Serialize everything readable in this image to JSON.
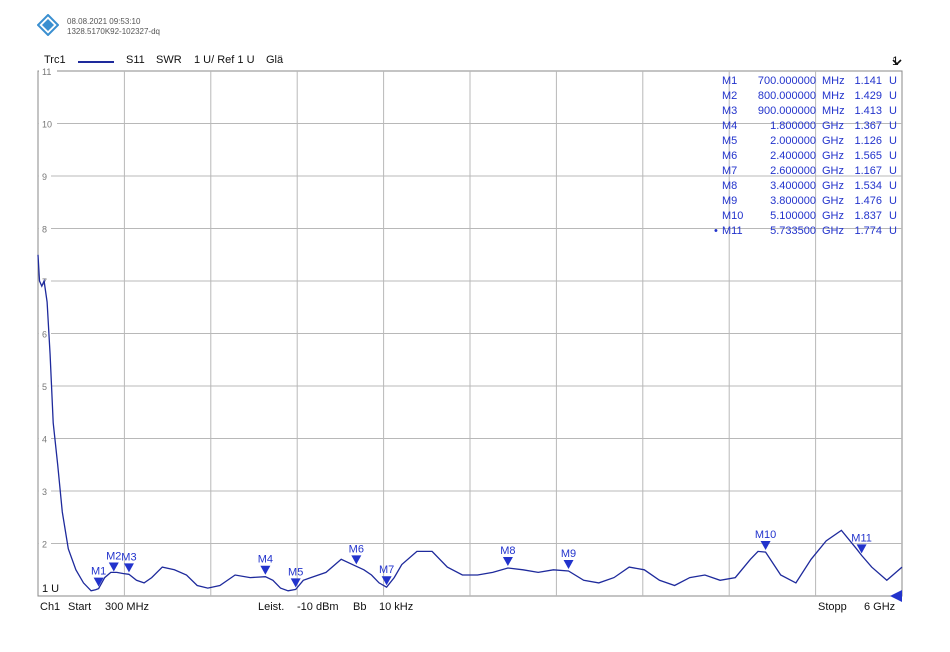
{
  "header": {
    "timestamp": "08.08.2021 09:53:10",
    "serial": "1328.5170K92-102327-dq"
  },
  "trace_bar": {
    "trace": "Trc1",
    "param": "S11",
    "format": "SWR",
    "scale": "1 U/ Ref 1 U",
    "smoothing": "Glä",
    "window": "1",
    "window_icon": "chevron-down-icon"
  },
  "colors": {
    "trace": "#1e2a9c",
    "marker": "#2233cc",
    "grid": "#b8b8b8",
    "frame": "#888888"
  },
  "footer": {
    "channel": "Ch1",
    "start_label": "Start",
    "start_value": "300 MHz",
    "power_label": "Leist.",
    "power_value": "-10 dBm",
    "bw_label": "Bb",
    "bw_value": "10 kHz",
    "stop_label": "Stopp",
    "stop_value": "6 GHz"
  },
  "chart_data": {
    "type": "line",
    "title": "",
    "xlabel": "",
    "ylabel": "",
    "xlim_ghz": [
      0.3,
      6.0
    ],
    "ylim": [
      1,
      11
    ],
    "yticks": [
      2,
      3,
      4,
      5,
      6,
      7,
      8,
      9,
      10,
      11
    ],
    "ref_label": "1 U",
    "grid": true,
    "series": [
      {
        "x_ghz": [
          0.3,
          0.31,
          0.325,
          0.34,
          0.36,
          0.38,
          0.4,
          0.43,
          0.46,
          0.5,
          0.55,
          0.6,
          0.65,
          0.68,
          0.7,
          0.74,
          0.78,
          0.82,
          0.86,
          0.9,
          0.95,
          1.0,
          1.05,
          1.12,
          1.2,
          1.28,
          1.35,
          1.42,
          1.5,
          1.6,
          1.7,
          1.8,
          1.85,
          1.9,
          1.95,
          2.0,
          2.05,
          2.1,
          2.2,
          2.3,
          2.4,
          2.45,
          2.5,
          2.55,
          2.6,
          2.65,
          2.7,
          2.8,
          2.9,
          3.0,
          3.1,
          3.2,
          3.3,
          3.4,
          3.5,
          3.6,
          3.7,
          3.8,
          3.9,
          4.0,
          4.1,
          4.2,
          4.3,
          4.4,
          4.5,
          4.6,
          4.7,
          4.8,
          4.9,
          5.0,
          5.05,
          5.1,
          5.2,
          5.3,
          5.4,
          5.5,
          5.6,
          5.7,
          5.7335,
          5.8,
          5.9,
          6.0
        ],
        "y": [
          7.5,
          7.0,
          6.9,
          7.0,
          6.6,
          5.6,
          4.3,
          3.5,
          2.6,
          1.9,
          1.5,
          1.25,
          1.1,
          1.12,
          1.141,
          1.35,
          1.45,
          1.45,
          1.429,
          1.413,
          1.3,
          1.25,
          1.35,
          1.55,
          1.5,
          1.4,
          1.2,
          1.15,
          1.2,
          1.4,
          1.35,
          1.367,
          1.3,
          1.15,
          1.1,
          1.126,
          1.3,
          1.35,
          1.45,
          1.7,
          1.565,
          1.5,
          1.4,
          1.25,
          1.167,
          1.35,
          1.6,
          1.85,
          1.85,
          1.55,
          1.4,
          1.4,
          1.45,
          1.534,
          1.5,
          1.45,
          1.5,
          1.476,
          1.3,
          1.25,
          1.35,
          1.55,
          1.5,
          1.3,
          1.2,
          1.35,
          1.4,
          1.3,
          1.35,
          1.7,
          1.85,
          1.837,
          1.4,
          1.25,
          1.7,
          2.05,
          2.25,
          1.9,
          1.774,
          1.55,
          1.3,
          1.55
        ]
      }
    ],
    "markers": [
      {
        "name": "M1",
        "x_ghz": 0.7,
        "y": 1.141,
        "freq": "700.000000",
        "unit": "MHz",
        "value": "1.141",
        "vunit": "U",
        "active": false
      },
      {
        "name": "M2",
        "x_ghz": 0.8,
        "y": 1.429,
        "freq": "800.000000",
        "unit": "MHz",
        "value": "1.429",
        "vunit": "U",
        "active": false
      },
      {
        "name": "M3",
        "x_ghz": 0.9,
        "y": 1.413,
        "freq": "900.000000",
        "unit": "MHz",
        "value": "1.413",
        "vunit": "U",
        "active": false
      },
      {
        "name": "M4",
        "x_ghz": 1.8,
        "y": 1.367,
        "freq": "1.800000",
        "unit": "GHz",
        "value": "1.367",
        "vunit": "U",
        "active": false
      },
      {
        "name": "M5",
        "x_ghz": 2.0,
        "y": 1.126,
        "freq": "2.000000",
        "unit": "GHz",
        "value": "1.126",
        "vunit": "U",
        "active": false
      },
      {
        "name": "M6",
        "x_ghz": 2.4,
        "y": 1.565,
        "freq": "2.400000",
        "unit": "GHz",
        "value": "1.565",
        "vunit": "U",
        "active": false
      },
      {
        "name": "M7",
        "x_ghz": 2.6,
        "y": 1.167,
        "freq": "2.600000",
        "unit": "GHz",
        "value": "1.167",
        "vunit": "U",
        "active": false
      },
      {
        "name": "M8",
        "x_ghz": 3.4,
        "y": 1.534,
        "freq": "3.400000",
        "unit": "GHz",
        "value": "1.534",
        "vunit": "U",
        "active": false
      },
      {
        "name": "M9",
        "x_ghz": 3.8,
        "y": 1.476,
        "freq": "3.800000",
        "unit": "GHz",
        "value": "1.476",
        "vunit": "U",
        "active": false
      },
      {
        "name": "M10",
        "x_ghz": 5.1,
        "y": 1.837,
        "freq": "5.100000",
        "unit": "GHz",
        "value": "1.837",
        "vunit": "U",
        "active": false
      },
      {
        "name": "M11",
        "x_ghz": 5.7335,
        "y": 1.774,
        "freq": "5.733500",
        "unit": "GHz",
        "value": "1.774",
        "vunit": "U",
        "active": true
      }
    ]
  }
}
